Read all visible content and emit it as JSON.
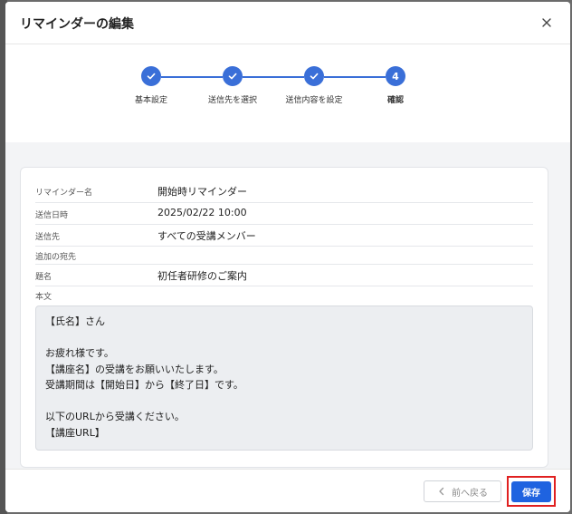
{
  "modal": {
    "title": "リマインダーの編集"
  },
  "stepper": {
    "steps": [
      {
        "label": "基本設定",
        "state": "done"
      },
      {
        "label": "送信先を選択",
        "state": "done"
      },
      {
        "label": "送信内容を設定",
        "state": "done"
      },
      {
        "label": "確認",
        "state": "current",
        "number": "4"
      }
    ]
  },
  "summary": {
    "rows": [
      {
        "label": "リマインダー名",
        "value": "開始時リマインダー"
      },
      {
        "label": "送信日時",
        "value": "2025/02/22 10:00"
      },
      {
        "label": "送信先",
        "value": "すべての受講メンバー"
      },
      {
        "label": "追加の宛先",
        "value": ""
      },
      {
        "label": "題名",
        "value": "初任者研修のご案内"
      }
    ],
    "body_label": "本文",
    "body_lines": [
      "【氏名】さん",
      "",
      "お疲れ様です。",
      "【講座名】の受講をお願いいたします。",
      "受講期間は【開始日】から【終了日】です。",
      "",
      "以下のURLから受講ください。",
      "【講座URL】"
    ]
  },
  "footer": {
    "back_label": "前へ戻る",
    "save_label": "保存"
  },
  "colors": {
    "accent": "#3a6fd8",
    "save": "#1f63e0",
    "highlight": "#e02020"
  }
}
